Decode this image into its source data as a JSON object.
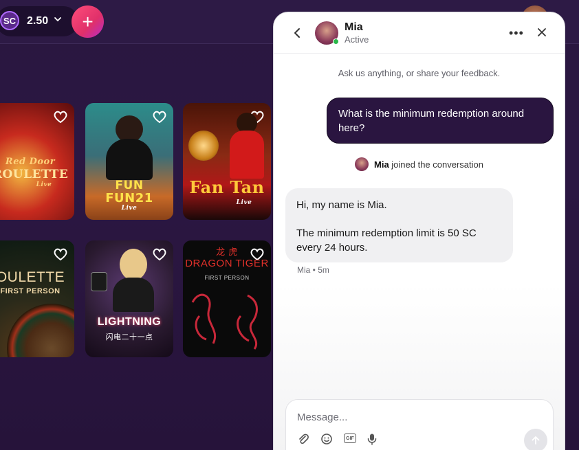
{
  "topbar": {
    "currency": "SC",
    "balance": "2.50",
    "add_symbol": "+"
  },
  "games": [
    {
      "title_line1": "Red Door",
      "title_line2": "ROULETTE",
      "tag": "Live",
      "icon": "heart-icon"
    },
    {
      "title_line1": "FUN",
      "title_line2": "FUN21",
      "tag": "Live",
      "icon": "heart-icon"
    },
    {
      "title_line1": "Fan Tan",
      "title_line2": "",
      "tag": "Live",
      "icon": "heart-icon"
    },
    {
      "title_line1": "OULETTE",
      "title_line2": "FIRST PERSON",
      "tag": "",
      "icon": "heart-icon"
    },
    {
      "title_line1": "LIGHTNING",
      "title_line2": "闪电二十一点",
      "tag": "",
      "icon": "heart-icon"
    },
    {
      "title_line1": "DRAGON TIGER",
      "title_line2": "FIRST PERSON",
      "tag": "龙 虎",
      "icon": "heart-icon"
    }
  ],
  "chat": {
    "agent_name": "Mia",
    "agent_status": "Active",
    "intro": "Ask us anything, or share your feedback.",
    "user_message": "What is the minimum redemption around here?",
    "joined_name": "Mia",
    "joined_suffix": " joined the conversation",
    "agent_line1": "Hi, my name is Mia.",
    "agent_line2": "The minimum redemption limit is 50 SC every 24 hours.",
    "meta": "Mia • 5m",
    "composer_placeholder": "Message...",
    "gif_label": "GIF"
  },
  "colors": {
    "page_bg": "#2a1740",
    "user_bubble": "#2a1540",
    "agent_bubble": "#f0f0f2",
    "add_button": "#e0306a",
    "online": "#2ab84a"
  }
}
